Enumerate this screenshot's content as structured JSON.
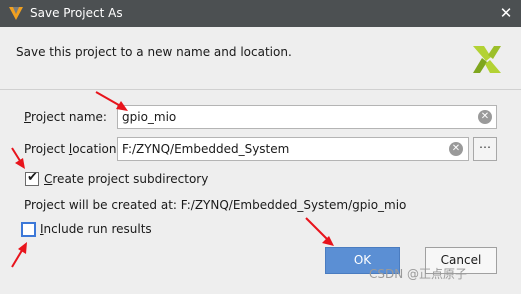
{
  "window": {
    "title": "Save Project As",
    "close_glyph": "✕",
    "logo_icon": "vivado-logo-icon"
  },
  "dialog": {
    "description": "Save this project to a new name and location.",
    "brand_icon": "xilinx-logo-icon"
  },
  "project_name": {
    "label_accel": "P",
    "label_rest": "roject name:",
    "value": "gpio_mio",
    "clear_glyph": "✕"
  },
  "project_location": {
    "label_start": "Project ",
    "label_accel": "l",
    "label_rest": "ocation:",
    "value": "F:/ZYNQ/Embedded_System",
    "clear_glyph": "✕",
    "browse_label": "⋯"
  },
  "create_subdirectory": {
    "checked": true,
    "check_glyph": "✔",
    "label_accel": "C",
    "label_rest": "reate project subdirectory"
  },
  "location_note": "Project will be created at: F:/ZYNQ/Embedded_System/gpio_mio",
  "include_run_results": {
    "checked": false,
    "label_accel": "I",
    "label_rest": "nclude run results"
  },
  "buttons": {
    "ok": "OK",
    "cancel": "Cancel"
  },
  "watermark": "CSDN @正点原子",
  "colors": {
    "titlebar": "#4c5052",
    "primary_button": "#5b8fd4",
    "annotation": "#e8141c",
    "xilinx_brand": "#9cbf2a"
  }
}
